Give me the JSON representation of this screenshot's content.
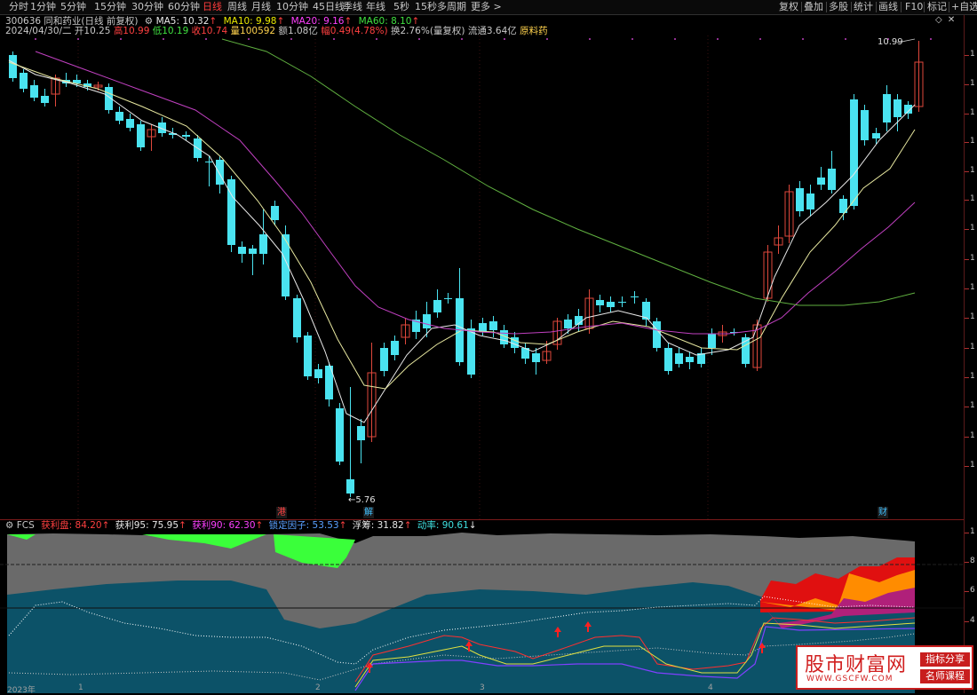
{
  "toolbar": {
    "tabs": [
      "分时",
      "1分钟",
      "5分钟",
      "15分钟",
      "30分钟",
      "60分钟",
      "日线",
      "周线",
      "月线",
      "10分钟",
      "45日线",
      "季线",
      "年线",
      "5秒",
      "15秒",
      "多周期",
      "更多 >"
    ],
    "active_tab": "日线",
    "right_items": [
      "复权",
      "叠加",
      "多股",
      "统计",
      "画线",
      "F10",
      "标记",
      "+自选"
    ]
  },
  "stock": {
    "code_name": "300636 同和药业(日线 前复权)",
    "ma5_label": "MA5: 10.32",
    "ma10_label": "MA10: 9.98",
    "ma20_label": "MA20: 9.16",
    "ma60_label": "MA60: 8.10",
    "date": "2024/04/30/二",
    "open": "开10.25",
    "high": "高10.99",
    "low": "低10.19",
    "close": "收10.74",
    "volume": "量100592",
    "amount": "额1.08亿",
    "change": "幅0.49(4.78%)",
    "turnover": "换2.76%(量复权)",
    "float_cap": "流通3.64亿",
    "concept": "原料药",
    "high_mark": "10.99",
    "low_mark": "5.76",
    "event_marks": [
      "港",
      "解",
      "财"
    ]
  },
  "indicator": {
    "name": "FCS",
    "profit_plate": "获利盘: 84.20",
    "profit95": "获利95: 75.95",
    "profit90": "获利90: 62.30",
    "lock_factor": "锁定因子: 53.53",
    "float_chips": "浮筹: 31.82",
    "momentum": "动率: 90.61"
  },
  "scale": {
    "price_ticks": [
      "1",
      "1",
      "1",
      "1",
      "1",
      "1",
      "1",
      "1",
      "1",
      "1",
      "1",
      "1",
      "1",
      "1",
      "1",
      "1",
      "1",
      "1",
      "1",
      "1",
      "1"
    ],
    "ind_ticks": [
      "1",
      "8",
      "6",
      "4"
    ]
  },
  "x_axis": {
    "labels": [
      "2023年",
      "1",
      "2",
      "3",
      "4"
    ]
  },
  "watermark": {
    "title": "股市财富网",
    "url": "WWW.GSCFW.COM",
    "tag1": "指标分享",
    "tag2": "名师课程"
  },
  "colors": {
    "up": "#e0483c",
    "down": "#4ae3f0",
    "ma5": "#e8e8e8",
    "ma10": "#e8e8a0",
    "ma20": "#c040c0",
    "ma60": "#60b040"
  }
}
